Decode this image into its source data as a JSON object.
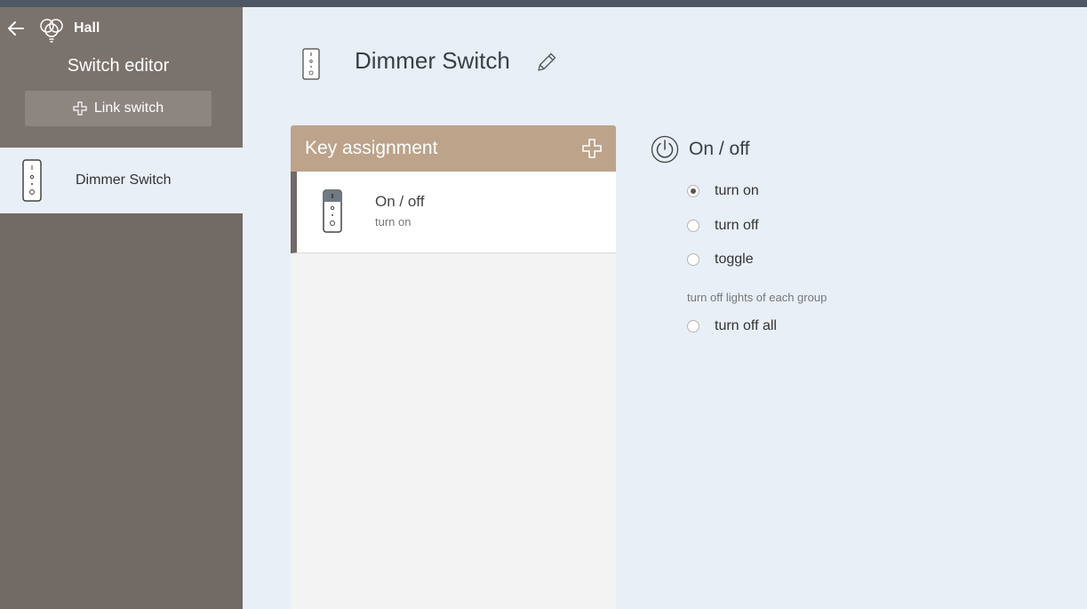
{
  "header": {
    "back_icon": "arrow-left-icon",
    "room_icon": "bulbs-icon",
    "room_name": "Hall",
    "title": "Switch editor"
  },
  "sidebar": {
    "link_button_label": "Link switch",
    "switches": [
      {
        "label": "Dimmer Switch",
        "icon": "dimmer-switch-icon",
        "selected": true
      }
    ]
  },
  "main": {
    "title": "Dimmer Switch",
    "key_assignment": {
      "title": "Key assignment",
      "items": [
        {
          "title": "On / off",
          "subtitle": "turn on"
        }
      ]
    },
    "action": {
      "title": "On / off",
      "options": [
        {
          "label": "turn on",
          "checked": true
        },
        {
          "label": "turn off",
          "checked": false
        },
        {
          "label": "toggle",
          "checked": false
        }
      ],
      "group_note": "turn off lights of each group",
      "group_option": {
        "label": "turn off all",
        "checked": false
      }
    }
  },
  "colors": {
    "sidebar": "#716a65",
    "accent": "#bca38a",
    "content_bg": "#e8eff6",
    "topbar": "#4e5864"
  }
}
